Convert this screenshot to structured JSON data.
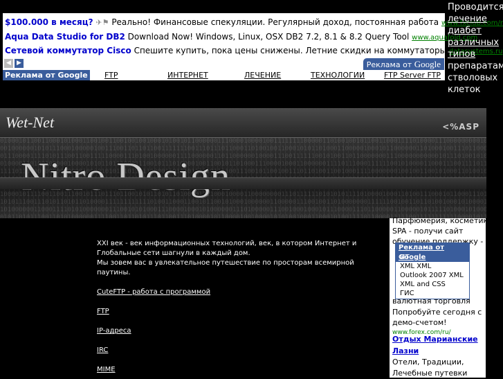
{
  "top_ads": [
    {
      "title": "$100.000 в месяц?",
      "flag": "✈⚑",
      "text": "Реально! Финансовые спекуляции. Регулярный доход, постоянная работа",
      "url": "www.fxclub.com/ru"
    },
    {
      "title": "Aqua Data Studio for DB2",
      "flag": "",
      "text": "Download Now! Windows, Linux, OSX DB2 7.2, 8.1 & 8.2 Query Tool",
      "url": "www.aquafold.com"
    },
    {
      "title": "Сетевой коммутатор Cisco",
      "flag": "",
      "text": "Спешите купить, пока цены снижены. Летние скидки на коммутаторы",
      "url": "datasystems.ru"
    }
  ],
  "ad_nav": {
    "prev": "◀",
    "next": "▶"
  },
  "google_badge": {
    "prefix": "Реклама от",
    "brand": "Google"
  },
  "link_row": {
    "label": "Реклама от Google",
    "links": [
      "FTP",
      "ИНТЕРНЕТ",
      "ЛЕЧЕНИЕ",
      "ТЕХНОЛОГИИ",
      "FTP Server FTP"
    ]
  },
  "promo_right": {
    "pre": "Проводится",
    "link": "лечение диабет различных типов",
    "post": "препаратами стволовых клеток"
  },
  "banner": {
    "site_name": "Wet-Net",
    "asp_mark": "<%ASP",
    "logo": "Nitro Design"
  },
  "main": {
    "intro1": "XXI век - век информационных технологий, век, в котором Интернет и Глобальные сети шагнули в каждый дом.",
    "intro2": "Мы зовем вас в увлекательное путешествие по просторам всемирной паутины.",
    "links": [
      "CuteFTP - работа с программой",
      "FTP",
      "IP-адреса",
      "IRC",
      "MIME"
    ]
  },
  "right_col": {
    "line1": "Парфюмерия, косметика,",
    "line2": "SPA - получи сайт",
    "line3": "обучение поддержку -",
    "valutnaya": "валютная торговля",
    "try_demo": "Попробуйте сегодня с",
    "demo": "демо-счетом!",
    "forex_url": "www.forex.com/ru/",
    "mariana_title": "Отдых Марианские",
    "mariana_title2": "Лазни",
    "traditions": "Отели, Традиции,",
    "tours": "Лечебные путевки"
  },
  "popup": {
    "header": "Реклама от Google",
    "items": [
      "ИТ",
      "XML XML",
      "Outlook 2007 XML",
      "XML and CSS",
      "ГИС"
    ]
  },
  "colors": {
    "accent": "#3a5d9c",
    "ad_title": "#0000cc",
    "ad_url": "#008000"
  }
}
